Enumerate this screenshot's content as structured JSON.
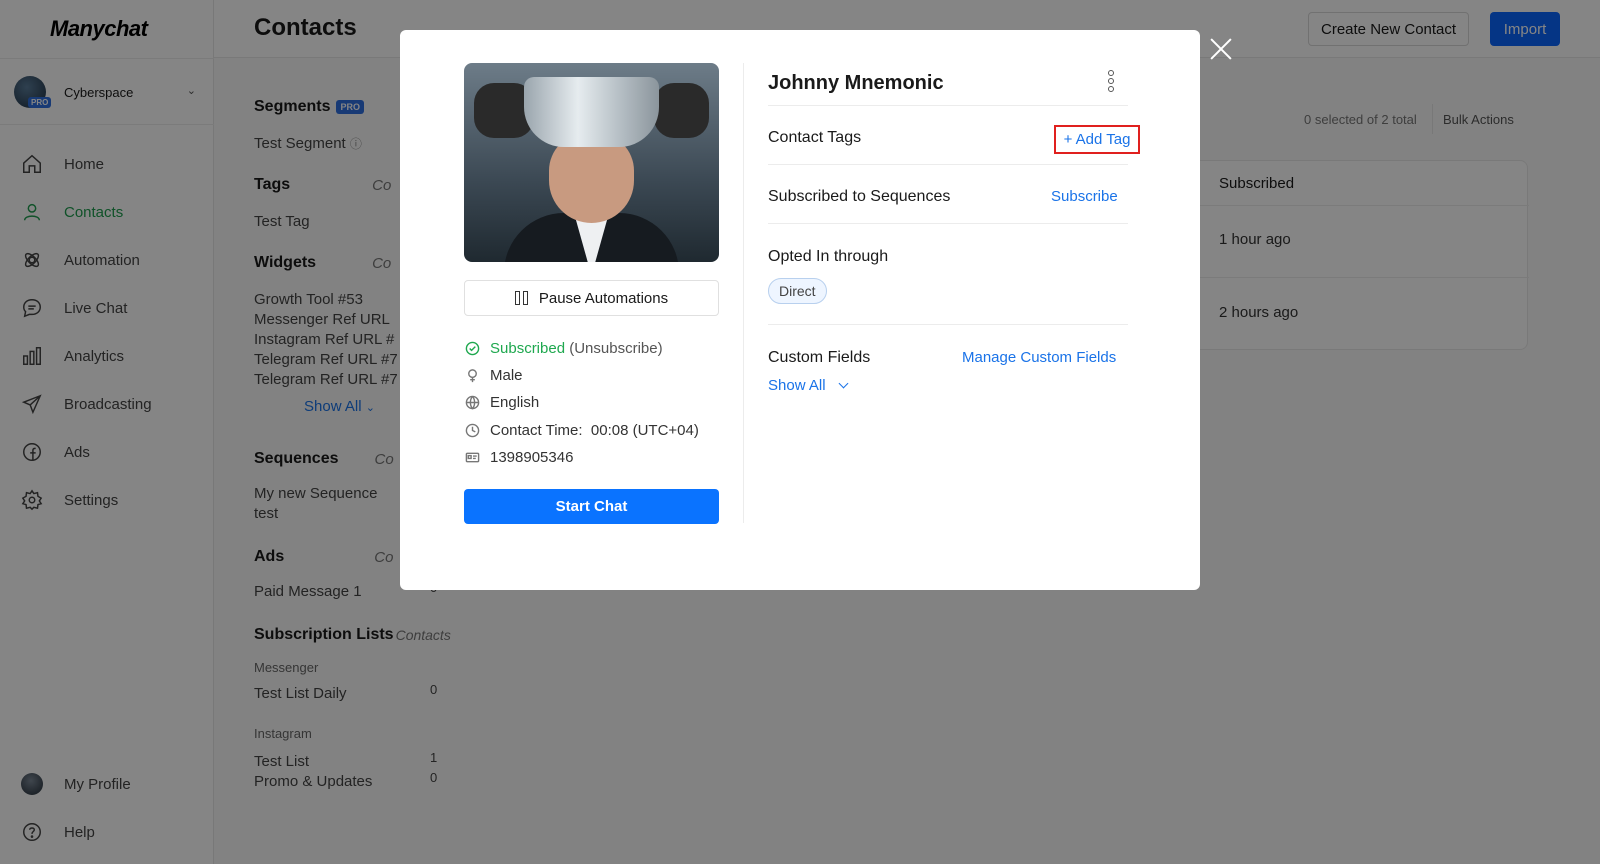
{
  "app": {
    "logo": "Manychat",
    "account_name": "Cyberspace",
    "account_badge": "PRO"
  },
  "nav": {
    "items": [
      {
        "label": "Home",
        "icon": "home-icon"
      },
      {
        "label": "Contacts",
        "icon": "user-icon",
        "active": true
      },
      {
        "label": "Automation",
        "icon": "automation-icon"
      },
      {
        "label": "Live Chat",
        "icon": "chat-icon"
      },
      {
        "label": "Analytics",
        "icon": "bar-chart-icon"
      },
      {
        "label": "Broadcasting",
        "icon": "send-icon"
      },
      {
        "label": "Ads",
        "icon": "facebook-icon"
      },
      {
        "label": "Settings",
        "icon": "gear-icon"
      }
    ],
    "bottom": [
      {
        "label": "My Profile",
        "icon": "avatar"
      },
      {
        "label": "Help",
        "icon": "help-icon"
      }
    ]
  },
  "header": {
    "title": "Contacts",
    "create_label": "Create New Contact",
    "import_label": "Import"
  },
  "filters": {
    "segments_title": "Segments",
    "segments_badge": "PRO",
    "segment_item": "Test Segment",
    "tags_title": "Tags",
    "contacts_sub": "Co",
    "tag_item": "Test Tag",
    "widgets_title": "Widgets",
    "widget_items": [
      "Growth Tool #53",
      "Messenger Ref URL",
      "Instagram Ref URL #",
      "Telegram Ref URL #7",
      "Telegram Ref URL #7"
    ],
    "show_all": "Show All",
    "sequences_title": "Sequences",
    "sequence_item_1": "My new Sequence",
    "sequence_item_2": "test",
    "ads_title": "Ads",
    "ads_item": "Paid Message 1",
    "ads_count": "0",
    "sublists_title": "Subscription Lists",
    "sublists_sub": "Contacts",
    "messenger_label": "Messenger",
    "list_daily": "Test List Daily",
    "list_daily_count": "0",
    "instagram_label": "Instagram",
    "list_test": "Test List",
    "list_test_count": "1",
    "list_promo": "Promo & Updates",
    "list_promo_count": "0"
  },
  "table": {
    "selected_info_a": "0 selected",
    "selected_info_b": "of",
    "selected_info_c": "2 total",
    "bulk_label": "Bulk Actions",
    "col_subscribed": "Subscribed",
    "rows": [
      "1 hour ago",
      "2 hours ago"
    ]
  },
  "modal": {
    "contact_name": "Johnny Mnemonic",
    "pause_label": "Pause Automations",
    "status_subscribed": "Subscribed",
    "status_unsub": "(Unsubscribe)",
    "gender": "Male",
    "language": "English",
    "contact_time_label": "Contact Time:",
    "contact_time_value": "00:08 (UTC+04)",
    "contact_id": "1398905346",
    "start_chat": "Start Chat",
    "tags_label": "Contact Tags",
    "add_tag": "+ Add Tag",
    "sequences_label": "Subscribed to Sequences",
    "subscribe_link": "Subscribe",
    "opted_label": "Opted In through",
    "opted_chip": "Direct",
    "custom_fields_label": "Custom Fields",
    "manage_link": "Manage Custom Fields",
    "show_all": "Show All"
  },
  "colors": {
    "primary": "#0a73ff",
    "active_nav": "#1f9d4f",
    "link": "#1a73e8",
    "highlight": "#e0201e"
  }
}
